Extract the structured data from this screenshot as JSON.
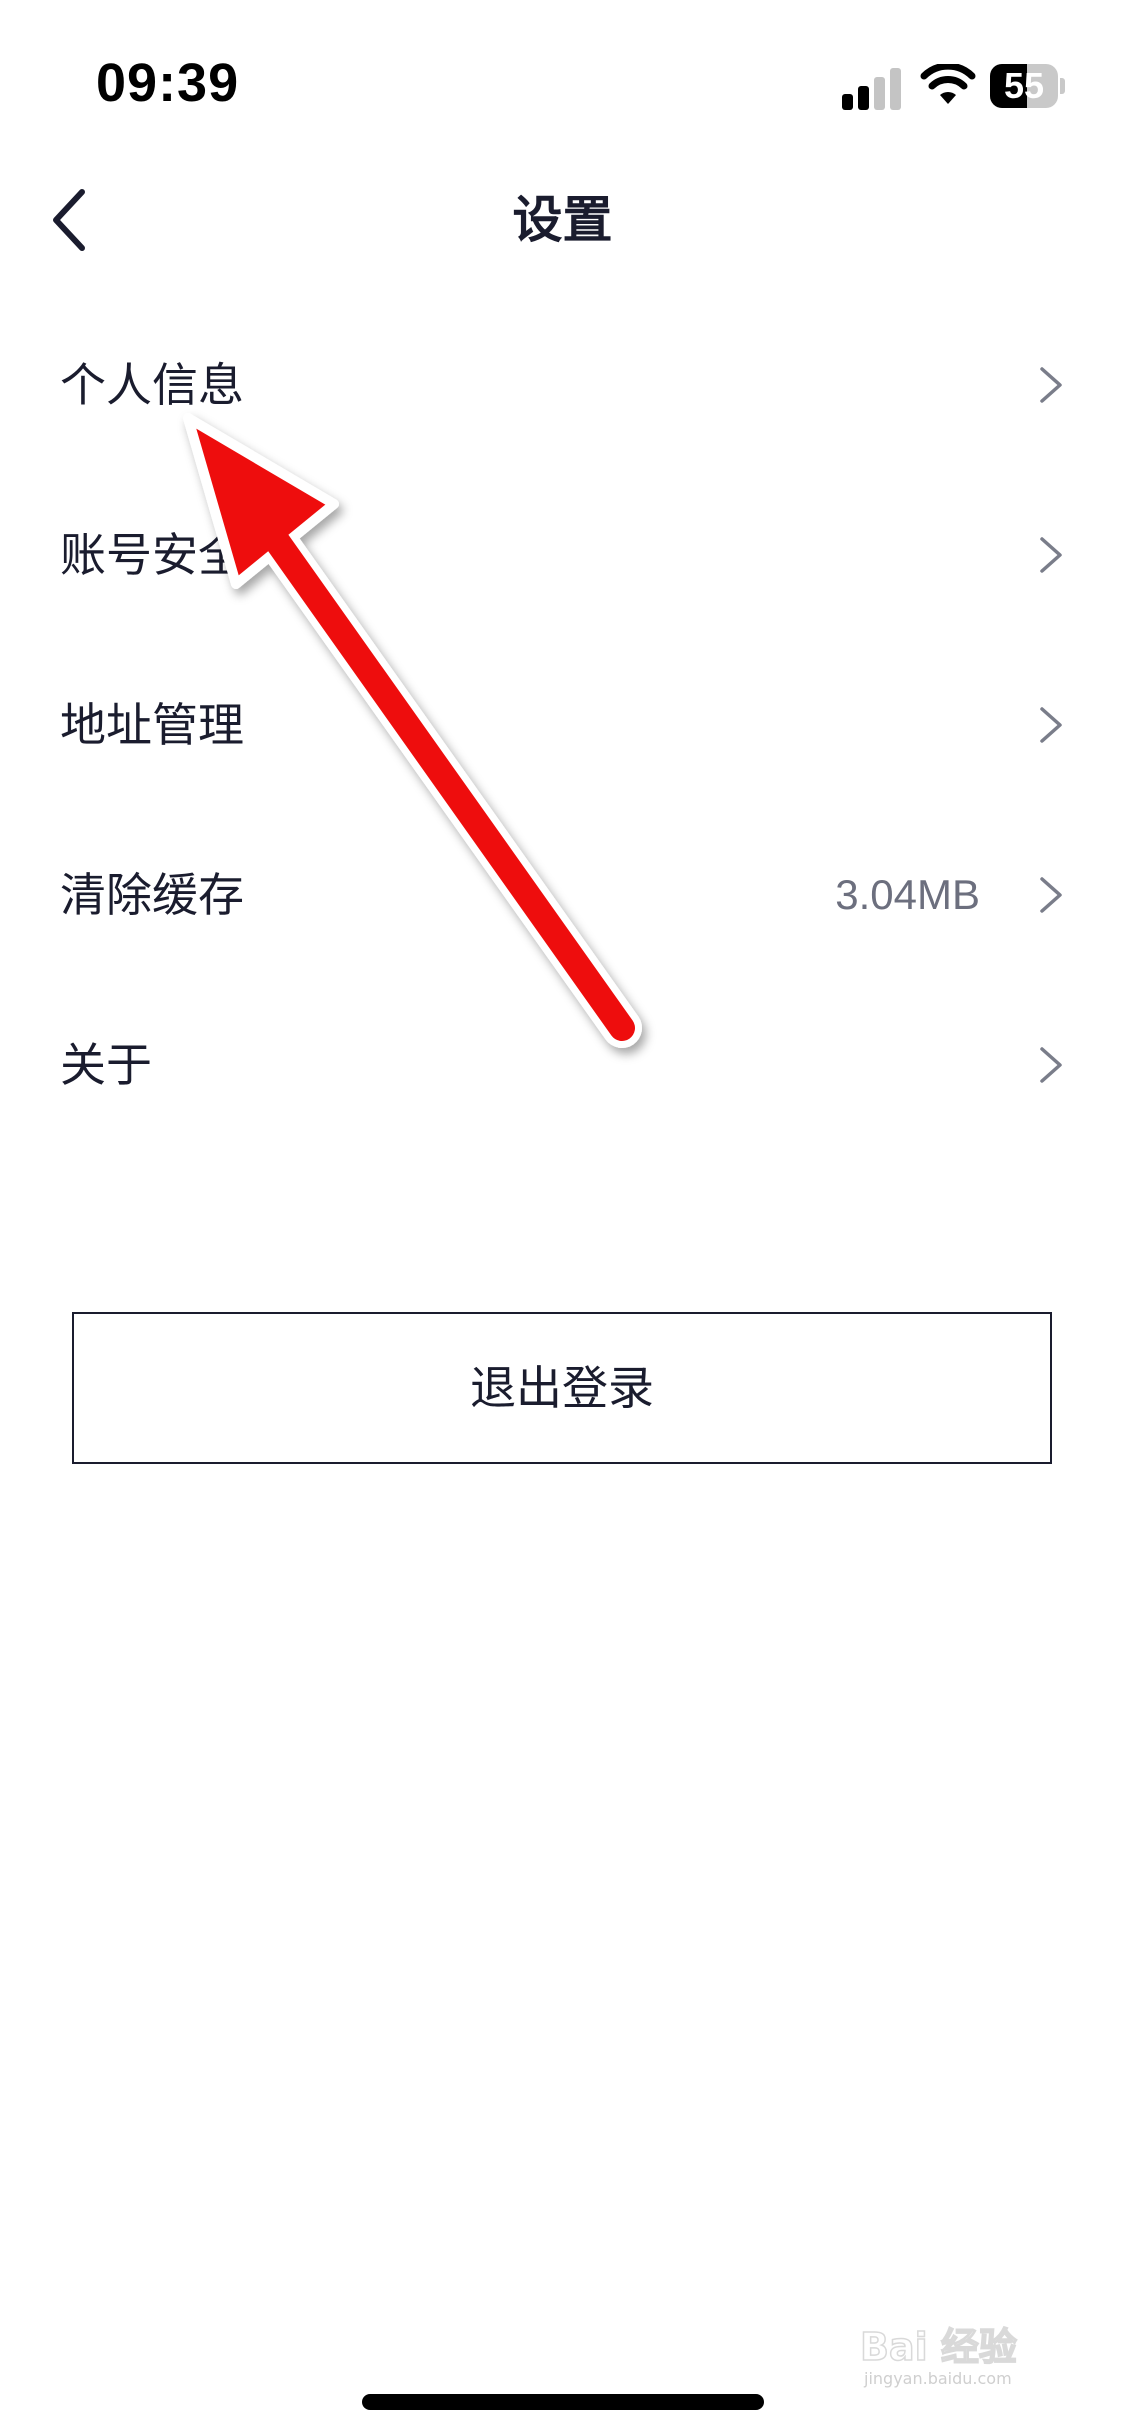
{
  "status_bar": {
    "time": "09:39",
    "battery_level": "55",
    "signal_bars_active": 2,
    "signal_bars_total": 4
  },
  "nav": {
    "title": "设置",
    "back_icon": "chevron-left-icon"
  },
  "settings": {
    "items": [
      {
        "label": "个人信息",
        "value": ""
      },
      {
        "label": "账号安全",
        "value": ""
      },
      {
        "label": "地址管理",
        "value": ""
      },
      {
        "label": "清除缓存",
        "value": "3.04MB"
      },
      {
        "label": "关于",
        "value": ""
      }
    ]
  },
  "logout": {
    "label": "退出登录"
  },
  "watermark": {
    "text": "Bai 经验",
    "subtext": "jingyan.baidu.com"
  },
  "colors": {
    "text_primary": "#1a1c2e",
    "text_secondary": "#6c6f7e",
    "chevron": "#7a7d8a",
    "annotation_arrow": "#ee1111"
  }
}
